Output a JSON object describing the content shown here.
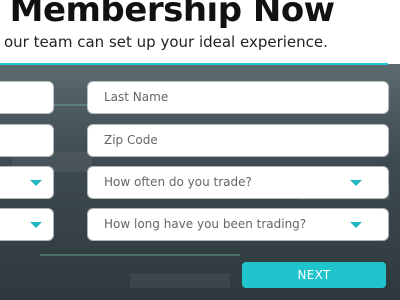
{
  "header": {
    "title": "r Membership Now",
    "subtitle": "o our team can set up your ideal experience."
  },
  "form": {
    "first_name": "",
    "last_name": "Last Name",
    "email": "",
    "zip_code": "Zip Code",
    "select_left_1": "",
    "trade_frequency": "How often do you trade?",
    "select_left_2": "",
    "trading_duration": "How long have you been trading?"
  },
  "actions": {
    "next_label": "NEXT"
  },
  "colors": {
    "accent": "#20c4cc",
    "rule": "#26c6d0",
    "text_dark": "#111111",
    "field_text": "#666666"
  }
}
